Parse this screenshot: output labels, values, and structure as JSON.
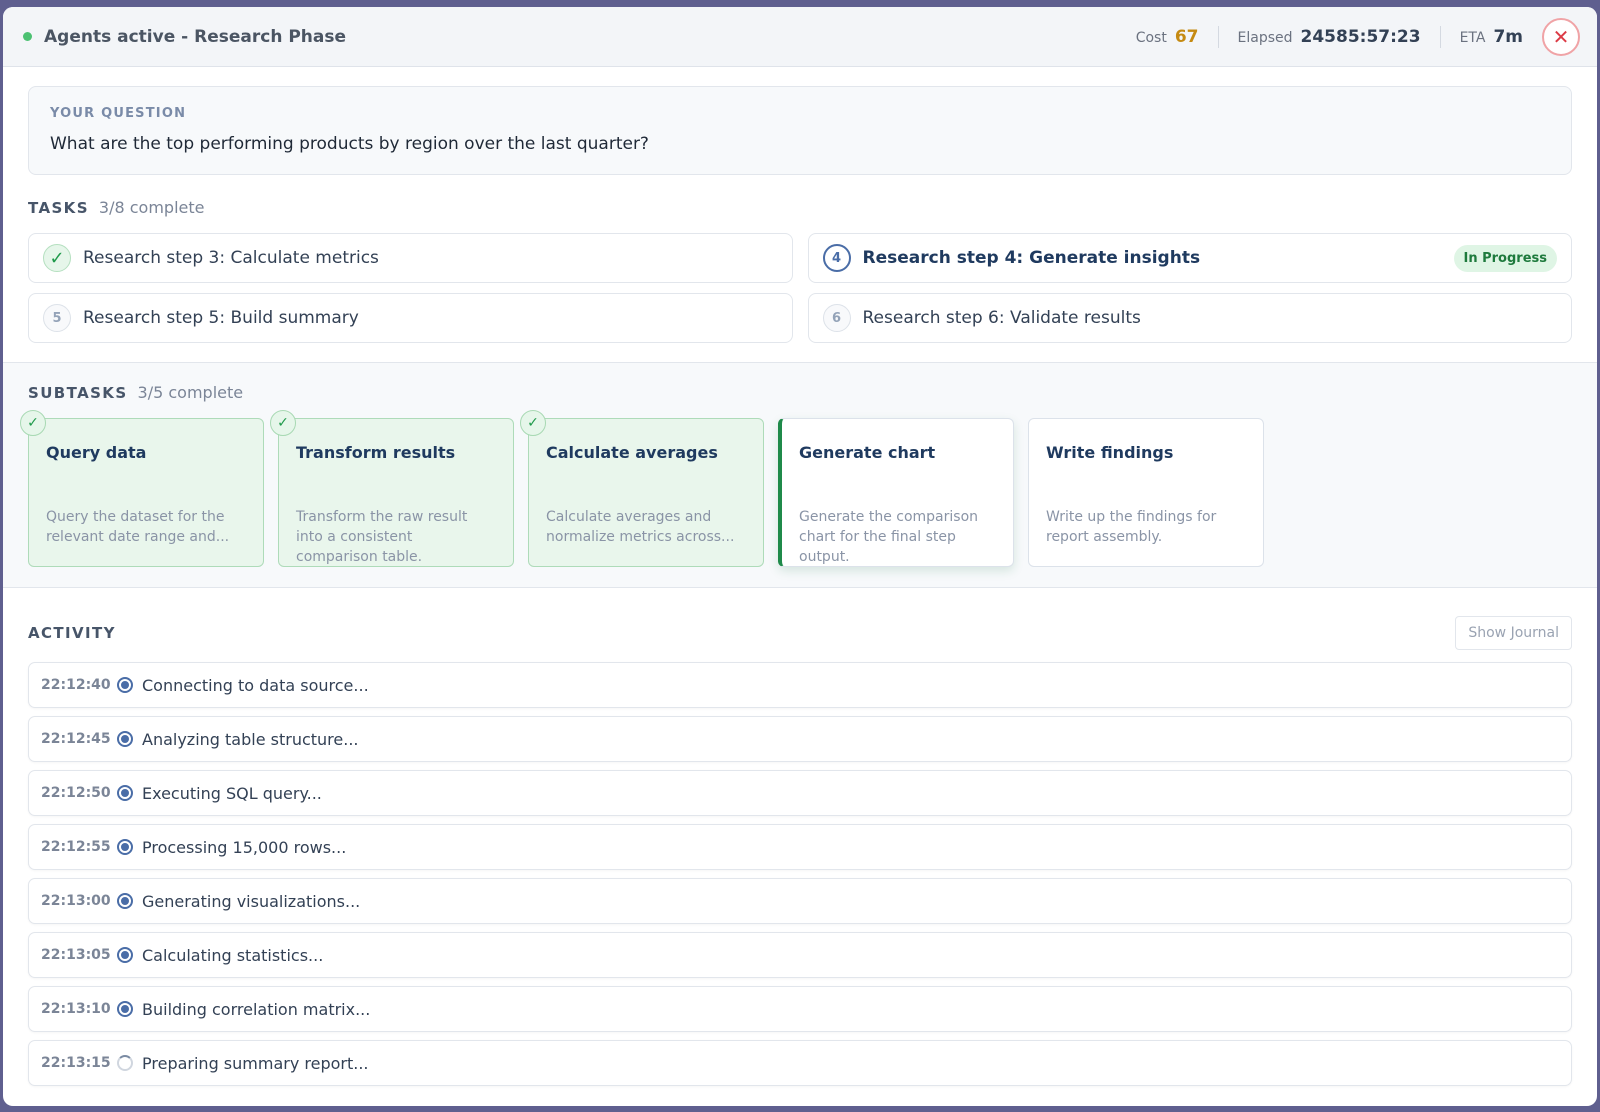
{
  "header": {
    "status_title": "Agents active - Research Phase",
    "cost_label": "Cost",
    "cost_value": "67",
    "elapsed_label": "Elapsed",
    "elapsed_value": "24585:57:23",
    "eta_label": "ETA",
    "eta_value": "7m",
    "close_icon": "close-icon",
    "status_color": "#4cc172"
  },
  "question": {
    "label": "YOUR QUESTION",
    "text": "What are the top performing products by region over the last quarter?"
  },
  "tasks": {
    "title": "TASKS",
    "count": "3/8 complete",
    "items": [
      {
        "badge": "✓",
        "label": "Research step 3: Calculate metrics",
        "state": "done"
      },
      {
        "badge": "4",
        "label": "Research step 4: Generate insights",
        "state": "active",
        "status": "In Progress"
      },
      {
        "badge": "5",
        "label": "Research step 5: Build summary",
        "state": "pending"
      },
      {
        "badge": "6",
        "label": "Research step 6: Validate results",
        "state": "pending"
      }
    ]
  },
  "subtasks": {
    "title": "SUBTASKS",
    "count": "3/5 complete",
    "items": [
      {
        "title": "Query data",
        "desc": "Query the dataset for the relevant date range and...",
        "state": "done"
      },
      {
        "title": "Transform results",
        "desc": "Transform the raw result into a consistent comparison table.",
        "state": "done"
      },
      {
        "title": "Calculate averages",
        "desc": "Calculate averages and normalize metrics across...",
        "state": "done"
      },
      {
        "title": "Generate chart",
        "desc": "Generate the comparison chart for the final step output.",
        "state": "active"
      },
      {
        "title": "Write findings",
        "desc": "Write up the findings for report assembly.",
        "state": "pending"
      }
    ]
  },
  "activity": {
    "title": "ACTIVITY",
    "journal_button": "Show Journal",
    "entries": [
      {
        "time": "22:12:40",
        "text": "Connecting to data source...",
        "state": "done"
      },
      {
        "time": "22:12:45",
        "text": "Analyzing table structure...",
        "state": "done"
      },
      {
        "time": "22:12:50",
        "text": "Executing SQL query...",
        "state": "done"
      },
      {
        "time": "22:12:55",
        "text": "Processing 15,000 rows...",
        "state": "done"
      },
      {
        "time": "22:13:00",
        "text": "Generating visualizations...",
        "state": "done"
      },
      {
        "time": "22:13:05",
        "text": "Calculating statistics...",
        "state": "done"
      },
      {
        "time": "22:13:10",
        "text": "Building correlation matrix...",
        "state": "done"
      },
      {
        "time": "22:13:15",
        "text": "Preparing summary report...",
        "state": "running"
      }
    ]
  }
}
